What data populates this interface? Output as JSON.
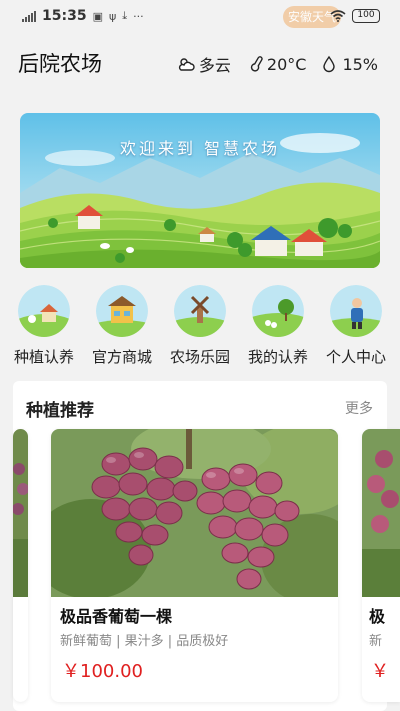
{
  "status_bar": {
    "time": "15:35",
    "chip_label": "安徽天气",
    "battery": "100"
  },
  "header": {
    "title": "后院农场",
    "weather": {
      "condition": "多云",
      "temperature": "20°C",
      "humidity": "15%"
    }
  },
  "banner": {
    "text": "欢迎来到 智慧农场"
  },
  "menu": {
    "items": [
      {
        "label": "种植认养",
        "icon": "planting-adopt-icon"
      },
      {
        "label": "官方商城",
        "icon": "official-mall-icon"
      },
      {
        "label": "农场乐园",
        "icon": "farm-park-icon"
      },
      {
        "label": "我的认养",
        "icon": "my-adoption-icon"
      },
      {
        "label": "个人中心",
        "icon": "personal-center-icon"
      }
    ]
  },
  "recommend": {
    "title": "种植推荐",
    "more": "更多",
    "cards": [
      {
        "name": "极品香葡萄一棵",
        "tags": "新鲜葡萄 | 果汁多 | 品质极好",
        "price": "￥100.00"
      }
    ],
    "next_card": {
      "name": "极",
      "tag": "新",
      "price": "￥"
    }
  },
  "colors": {
    "price": "#e02020",
    "banner_sky": "#6ec8ea",
    "field_green": "#8fcf4a"
  }
}
